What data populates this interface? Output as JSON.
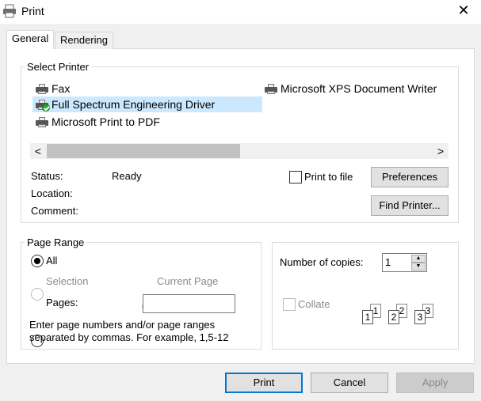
{
  "window": {
    "title": "Print",
    "close_glyph": "✕"
  },
  "tabs": [
    {
      "label": "General",
      "active": true
    },
    {
      "label": "Rendering",
      "active": false
    }
  ],
  "select_printer": {
    "legend": "Select Printer",
    "printers": [
      {
        "name": "Fax",
        "icon": "printer-icon",
        "selected": false,
        "default": false
      },
      {
        "name": "Full Spectrum Engineering Driver",
        "icon": "printer-icon",
        "selected": true,
        "default": true
      },
      {
        "name": "Microsoft Print to PDF",
        "icon": "printer-icon",
        "selected": false,
        "default": false
      },
      {
        "name": "Microsoft XPS Document Writer",
        "icon": "printer-icon",
        "selected": false,
        "default": false
      }
    ],
    "scroll_left": "<",
    "scroll_right": ">",
    "status_label": "Status:",
    "status_value": "Ready",
    "location_label": "Location:",
    "comment_label": "Comment:",
    "print_to_file_label": "Print to file",
    "print_to_file_checked": false,
    "preferences_label": "Preferences",
    "find_printer_label": "Find Printer..."
  },
  "page_range": {
    "legend": "Page Range",
    "all_label": "All",
    "selection_label": "Selection",
    "current_page_label": "Current Page",
    "pages_label": "Pages:",
    "pages_value": "",
    "selected": "All",
    "hint": "Enter page numbers and/or page ranges\nseparated by commas.  For example, 1,5-12"
  },
  "copies": {
    "label": "Number of copies:",
    "value": "1",
    "collate_label": "Collate",
    "collate_checked": false,
    "collate_pages": [
      "1",
      "1",
      "2",
      "2",
      "3",
      "3"
    ]
  },
  "buttons": {
    "print": "Print",
    "cancel": "Cancel",
    "apply": "Apply"
  },
  "colors": {
    "selection": "#cce8ff",
    "default_badge": "#2aa52a",
    "focus_border": "#0078d7"
  }
}
